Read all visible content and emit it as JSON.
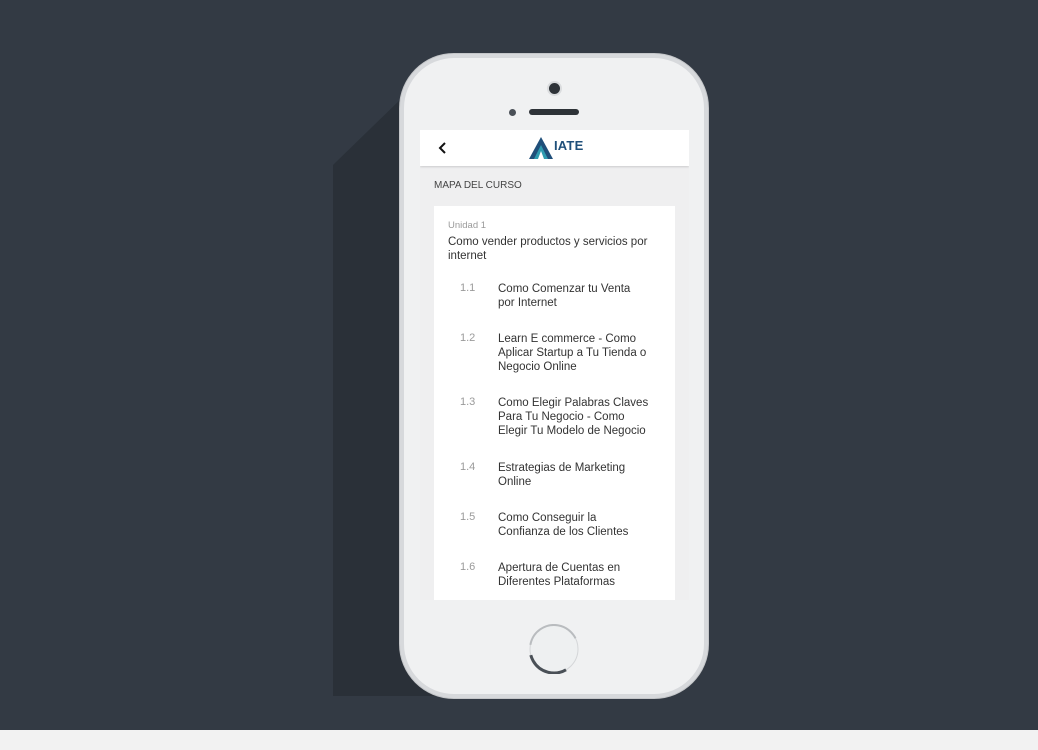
{
  "app": {
    "logo_text": "IATE",
    "back_icon": "chevron-left-icon",
    "colors": {
      "logo_blue": "#1f4f7a",
      "logo_teal": "#2e9bb0",
      "background": "#333a44"
    }
  },
  "course_map": {
    "section_title": "MAPA DEL CURSO",
    "unit": {
      "label": "Unidad 1",
      "title": "Como vender productos y servicios por internet"
    },
    "lessons": [
      {
        "num": "1.1",
        "title": "Como Comenzar tu Venta por Internet"
      },
      {
        "num": "1.2",
        "title": "Learn E commerce - Como Aplicar Startup a Tu Tienda o Negocio Online"
      },
      {
        "num": "1.3",
        "title": "Como Elegir Palabras Claves Para Tu Negocio - Como Elegir Tu Modelo de Negocio"
      },
      {
        "num": "1.4",
        "title": "Estrategias de Marketing Online"
      },
      {
        "num": "1.5",
        "title": "Como Conseguir la Confianza de los Clientes"
      },
      {
        "num": "1.6",
        "title": "Apertura de Cuentas en Diferentes Plataformas"
      }
    ]
  }
}
